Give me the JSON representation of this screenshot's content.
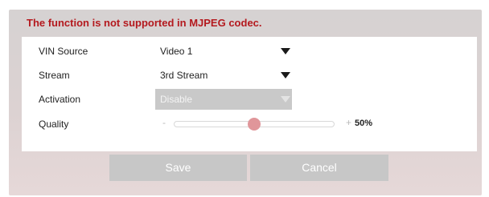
{
  "warning": "The function is not supported in MJPEG codec.",
  "form": {
    "vin_source": {
      "label": "VIN Source",
      "value": "Video 1"
    },
    "stream": {
      "label": "Stream",
      "value": "3rd Stream"
    },
    "activation": {
      "label": "Activation",
      "value": "Disable",
      "disabled": true
    },
    "quality": {
      "label": "Quality",
      "minus": "-",
      "plus": "+",
      "value_text": "50%",
      "value": 50
    }
  },
  "buttons": {
    "save": "Save",
    "cancel": "Cancel"
  },
  "colors": {
    "warning": "#b4191e",
    "slider_thumb": "#e0969a",
    "button_bg": "#c7c7c7"
  },
  "icons": {
    "dropdown": "caret-down-icon"
  }
}
